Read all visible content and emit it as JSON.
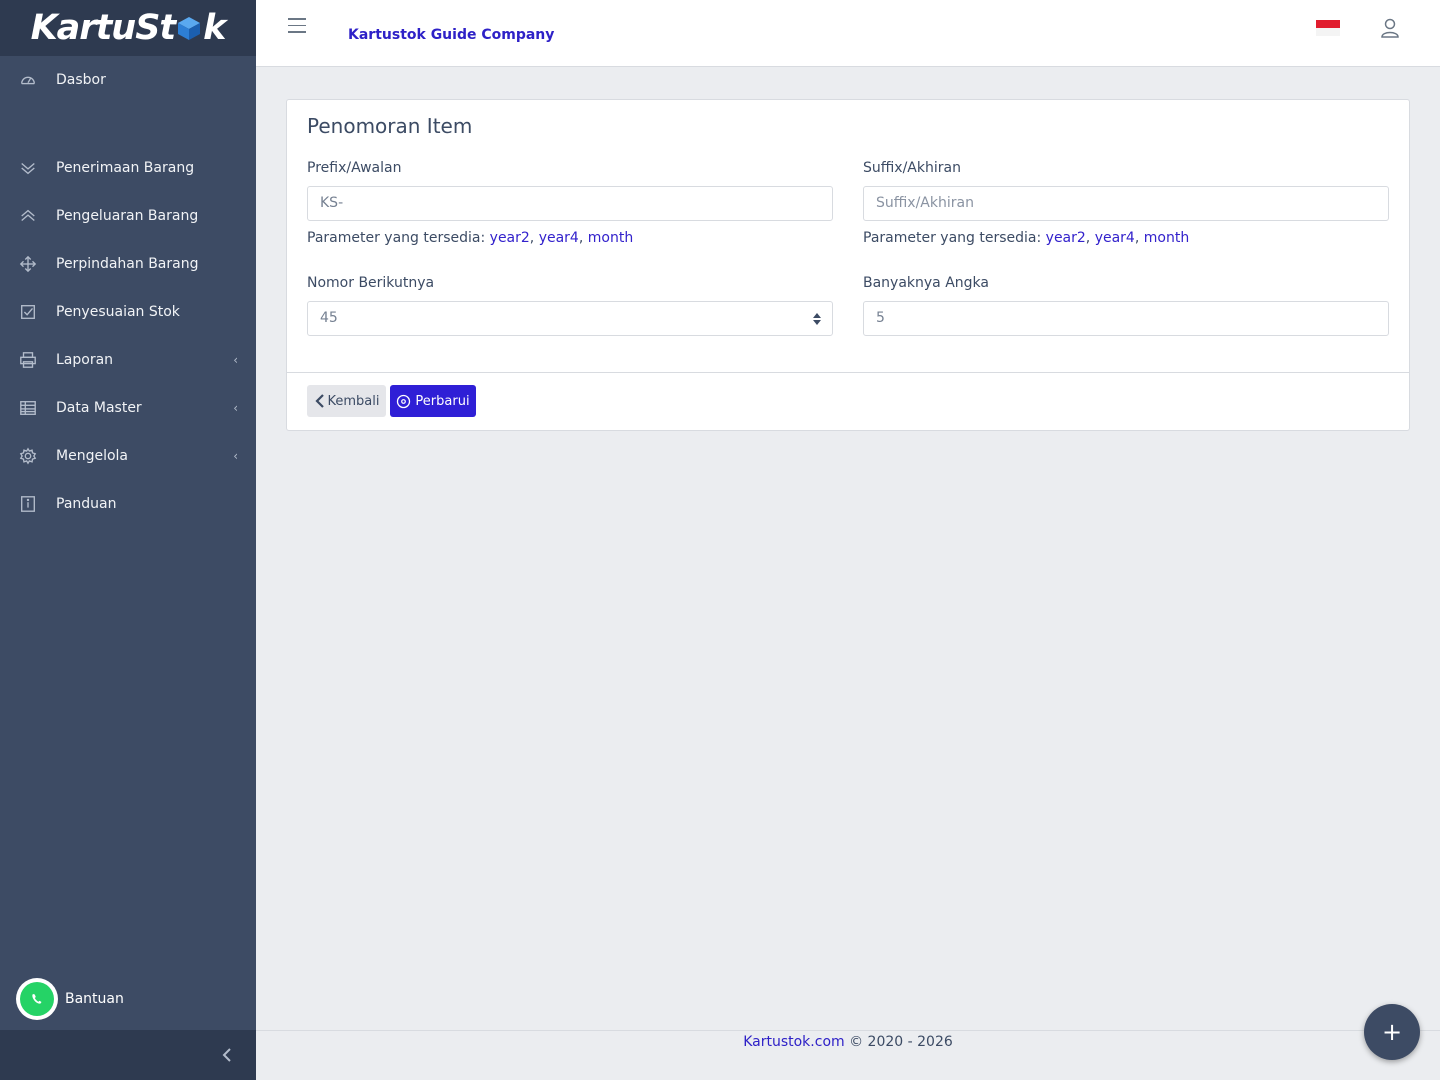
{
  "brand": {
    "logo_text_a": "KartuSt",
    "logo_text_b": "k"
  },
  "sidebar": {
    "items": [
      {
        "label": "Dasbor",
        "icon": "speedometer-icon"
      },
      {
        "label": "Penerimaan Barang",
        "icon": "chevron-double-down-icon"
      },
      {
        "label": "Pengeluaran Barang",
        "icon": "chevron-double-up-icon"
      },
      {
        "label": "Perpindahan Barang",
        "icon": "move-icon"
      },
      {
        "label": "Penyesuaian Stok",
        "icon": "check-square-icon"
      },
      {
        "label": "Laporan",
        "icon": "printer-icon",
        "caret": "‹"
      },
      {
        "label": "Data Master",
        "icon": "spreadsheet-icon",
        "caret": "‹"
      },
      {
        "label": "Mengelola",
        "icon": "gear-icon",
        "caret": "‹"
      },
      {
        "label": "Panduan",
        "icon": "info-icon"
      }
    ],
    "help_label": "Bantuan"
  },
  "header": {
    "company": "Kartustok Guide Company",
    "language_flag": "indonesia-flag-icon"
  },
  "form": {
    "title": "Penomoran Item",
    "prefix": {
      "label": "Prefix/Awalan",
      "value": "KS-",
      "placeholder": ""
    },
    "suffix": {
      "label": "Suffix/Akhiran",
      "value": "",
      "placeholder": "Suffix/Akhiran"
    },
    "params_label": "Parameter yang tersedia:",
    "params": [
      "year2",
      "year4",
      "month"
    ],
    "next_number": {
      "label": "Nomor Berikutnya",
      "value": "45"
    },
    "digits": {
      "label": "Banyaknya Angka",
      "value": "5"
    },
    "back_label": "Kembali",
    "update_label": "Perbarui"
  },
  "footer": {
    "link": "Kartustok.com",
    "copyright": "© 2020 - 2026"
  },
  "colors": {
    "sidebar": "#3d4b64",
    "sidebar_dark": "#2e3a50",
    "accent": "#2f1fd6",
    "link": "#3322cc"
  },
  "fab": {
    "label": "+"
  }
}
